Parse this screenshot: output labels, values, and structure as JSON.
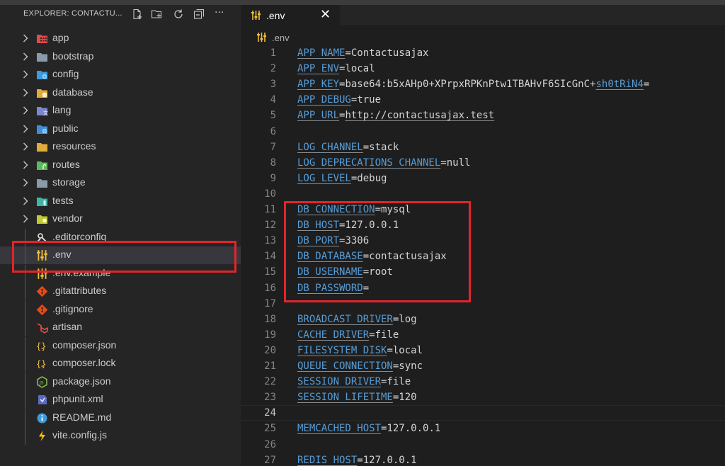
{
  "sidebar": {
    "title": "EXPLORER: CONTACTU...",
    "header_icons": [
      "new-file-icon",
      "new-folder-icon",
      "refresh-icon",
      "collapse-all-icon",
      "more-icon"
    ],
    "more_label": "···",
    "items": [
      {
        "label": "app",
        "kind": "folder",
        "icon": "app-folder-icon",
        "color": "#e04b4b"
      },
      {
        "label": "bootstrap",
        "kind": "folder",
        "icon": "folder-icon",
        "color": "#8a9aa8"
      },
      {
        "label": "config",
        "kind": "folder",
        "icon": "config-folder-icon",
        "color": "#3d9bdb"
      },
      {
        "label": "database",
        "kind": "folder",
        "icon": "database-folder-icon",
        "color": "#e2a93b"
      },
      {
        "label": "lang",
        "kind": "folder",
        "icon": "lang-folder-icon",
        "color": "#7d88c9"
      },
      {
        "label": "public",
        "kind": "folder",
        "icon": "public-folder-icon",
        "color": "#3d8fdb"
      },
      {
        "label": "resources",
        "kind": "folder",
        "icon": "resources-folder-icon",
        "color": "#e2a93b"
      },
      {
        "label": "routes",
        "kind": "folder",
        "icon": "routes-folder-icon",
        "color": "#5cb85c"
      },
      {
        "label": "storage",
        "kind": "folder",
        "icon": "folder-icon",
        "color": "#8a9aa8"
      },
      {
        "label": "tests",
        "kind": "folder",
        "icon": "tests-folder-icon",
        "color": "#3fb6a4"
      },
      {
        "label": "vendor",
        "kind": "folder",
        "icon": "vendor-folder-icon",
        "color": "#c0ca33"
      },
      {
        "label": ".editorconfig",
        "kind": "file",
        "icon": "editorconfig-icon",
        "color": "#e8e8e8"
      },
      {
        "label": ".env",
        "kind": "file",
        "icon": "env-icon",
        "color": "#f2c037",
        "selected": true
      },
      {
        "label": ".env.example",
        "kind": "file",
        "icon": "env-icon",
        "color": "#f2c037"
      },
      {
        "label": ".gitattributes",
        "kind": "file",
        "icon": "git-icon",
        "color": "#e64a19"
      },
      {
        "label": ".gitignore",
        "kind": "file",
        "icon": "git-icon",
        "color": "#e64a19"
      },
      {
        "label": "artisan",
        "kind": "file",
        "icon": "laravel-icon",
        "color": "#f05340"
      },
      {
        "label": "composer.json",
        "kind": "file",
        "icon": "json-icon",
        "color": "#f2c037"
      },
      {
        "label": "composer.lock",
        "kind": "file",
        "icon": "json-icon",
        "color": "#f2c037"
      },
      {
        "label": "package.json",
        "kind": "file",
        "icon": "nodejs-icon",
        "color": "#8bc34a"
      },
      {
        "label": "phpunit.xml",
        "kind": "file",
        "icon": "phpunit-icon",
        "color": "#5c6bc0"
      },
      {
        "label": "README.md",
        "kind": "file",
        "icon": "info-icon",
        "color": "#3d9bdb"
      },
      {
        "label": "vite.config.js",
        "kind": "file",
        "icon": "vite-icon",
        "color": "#ffc400"
      }
    ]
  },
  "editor": {
    "tab_label": ".env",
    "tab_close": "✕",
    "breadcrumb": ".env",
    "current_line": 24,
    "lines": [
      {
        "n": "1",
        "key": "APP_NAME",
        "value": "Contactusajax",
        "vstyle": "plain"
      },
      {
        "n": "2",
        "key": "APP_ENV",
        "value": "local",
        "vstyle": "plain"
      },
      {
        "n": "3",
        "key": "APP_KEY",
        "value": "base64:b5xAHp0+XPrpxRPKnPtw1TBAHvF6SIcGnC+",
        "value2": "sh0tRiN4",
        "value3": "=",
        "vstyle": "key"
      },
      {
        "n": "4",
        "key": "APP_DEBUG",
        "value": "true",
        "vstyle": "plain"
      },
      {
        "n": "5",
        "key": "APP_URL",
        "value": "http://contactusajax.test",
        "vstyle": "link"
      },
      {
        "n": "6"
      },
      {
        "n": "7",
        "key": "LOG_CHANNEL",
        "value": "stack",
        "vstyle": "plain"
      },
      {
        "n": "8",
        "key": "LOG_DEPRECATIONS_CHANNEL",
        "value": "null",
        "vstyle": "plain"
      },
      {
        "n": "9",
        "key": "LOG_LEVEL",
        "value": "debug",
        "vstyle": "plain"
      },
      {
        "n": "10"
      },
      {
        "n": "11",
        "key": "DB_CONNECTION",
        "value": "mysql",
        "vstyle": "plain"
      },
      {
        "n": "12",
        "key": "DB_HOST",
        "value": "127.0.0.1",
        "vstyle": "plain"
      },
      {
        "n": "13",
        "key": "DB_PORT",
        "value": "3306",
        "vstyle": "plain"
      },
      {
        "n": "14",
        "key": "DB_DATABASE",
        "value": "contactusajax",
        "vstyle": "plain"
      },
      {
        "n": "15",
        "key": "DB_USERNAME",
        "value": "root",
        "vstyle": "plain"
      },
      {
        "n": "16",
        "key": "DB_PASSWORD",
        "value": "",
        "vstyle": "plain"
      },
      {
        "n": "17"
      },
      {
        "n": "18",
        "key": "BROADCAST_DRIVER",
        "value": "log",
        "vstyle": "plain"
      },
      {
        "n": "19",
        "key": "CACHE_DRIVER",
        "value": "file",
        "vstyle": "plain"
      },
      {
        "n": "20",
        "key": "FILESYSTEM_DISK",
        "value": "local",
        "vstyle": "plain"
      },
      {
        "n": "21",
        "key": "QUEUE_CONNECTION",
        "value": "sync",
        "vstyle": "plain"
      },
      {
        "n": "22",
        "key": "SESSION_DRIVER",
        "value": "file",
        "vstyle": "plain"
      },
      {
        "n": "23",
        "key": "SESSION_LIFETIME",
        "value": "120",
        "vstyle": "plain"
      },
      {
        "n": "24"
      },
      {
        "n": "25",
        "key": "MEMCACHED_HOST",
        "value": "127.0.0.1",
        "vstyle": "plain"
      },
      {
        "n": "26"
      },
      {
        "n": "27",
        "key": "REDIS_HOST",
        "value": "127.0.0.1",
        "vstyle": "plain"
      }
    ]
  },
  "annotations": {
    "highlight_color": "#e3242b",
    "highlighted_file": ".env",
    "highlighted_lines": [
      "11",
      "16"
    ]
  }
}
